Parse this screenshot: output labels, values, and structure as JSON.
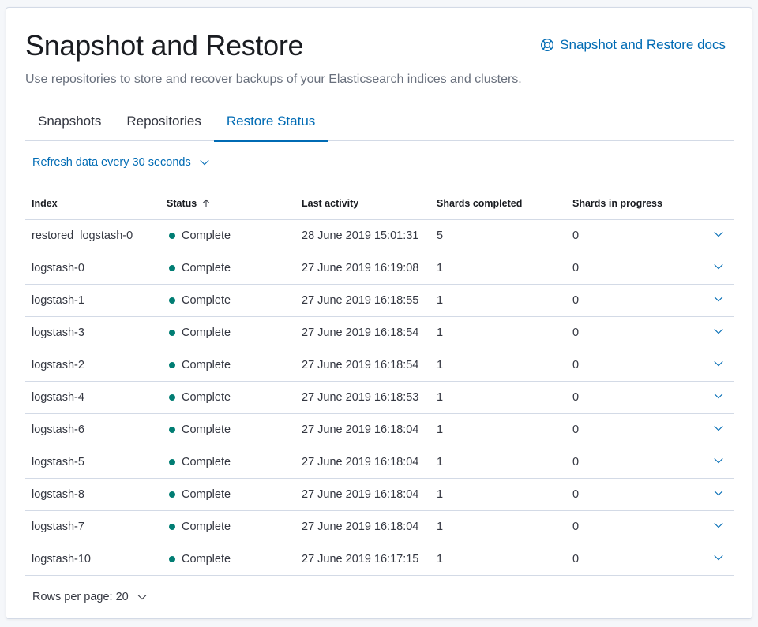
{
  "header": {
    "title": "Snapshot and Restore",
    "description": "Use repositories to store and recover backups of your Elasticsearch indices and clusters.",
    "docs_link": "Snapshot and Restore docs"
  },
  "tabs": [
    {
      "label": "Snapshots",
      "active": false
    },
    {
      "label": "Repositories",
      "active": false
    },
    {
      "label": "Restore Status",
      "active": true
    }
  ],
  "refresh": {
    "label": "Refresh data every 30 seconds"
  },
  "table": {
    "columns": [
      "Index",
      "Status",
      "Last activity",
      "Shards completed",
      "Shards in progress"
    ],
    "sorted_column": "Status",
    "sort_direction": "ascending",
    "rows": [
      {
        "index": "restored_logstash-0",
        "status": "Complete",
        "last_activity": "28 June 2019 15:01:31",
        "shards_completed": "5",
        "shards_in_progress": "0"
      },
      {
        "index": "logstash-0",
        "status": "Complete",
        "last_activity": "27 June 2019 16:19:08",
        "shards_completed": "1",
        "shards_in_progress": "0"
      },
      {
        "index": "logstash-1",
        "status": "Complete",
        "last_activity": "27 June 2019 16:18:55",
        "shards_completed": "1",
        "shards_in_progress": "0"
      },
      {
        "index": "logstash-3",
        "status": "Complete",
        "last_activity": "27 June 2019 16:18:54",
        "shards_completed": "1",
        "shards_in_progress": "0"
      },
      {
        "index": "logstash-2",
        "status": "Complete",
        "last_activity": "27 June 2019 16:18:54",
        "shards_completed": "1",
        "shards_in_progress": "0"
      },
      {
        "index": "logstash-4",
        "status": "Complete",
        "last_activity": "27 June 2019 16:18:53",
        "shards_completed": "1",
        "shards_in_progress": "0"
      },
      {
        "index": "logstash-6",
        "status": "Complete",
        "last_activity": "27 June 2019 16:18:04",
        "shards_completed": "1",
        "shards_in_progress": "0"
      },
      {
        "index": "logstash-5",
        "status": "Complete",
        "last_activity": "27 June 2019 16:18:04",
        "shards_completed": "1",
        "shards_in_progress": "0"
      },
      {
        "index": "logstash-8",
        "status": "Complete",
        "last_activity": "27 June 2019 16:18:04",
        "shards_completed": "1",
        "shards_in_progress": "0"
      },
      {
        "index": "logstash-7",
        "status": "Complete",
        "last_activity": "27 June 2019 16:18:04",
        "shards_completed": "1",
        "shards_in_progress": "0"
      },
      {
        "index": "logstash-10",
        "status": "Complete",
        "last_activity": "27 June 2019 16:17:15",
        "shards_completed": "1",
        "shards_in_progress": "0"
      }
    ]
  },
  "pagination": {
    "label": "Rows per page: 20"
  },
  "colors": {
    "accent": "#006bb4",
    "status_complete": "#017d73",
    "border": "#d3dae6"
  },
  "icons": {
    "docs": "help-lifebuoy-icon",
    "dropdown": "chevron-down-icon",
    "sort": "arrow-up-icon",
    "expand": "chevron-down-icon"
  }
}
